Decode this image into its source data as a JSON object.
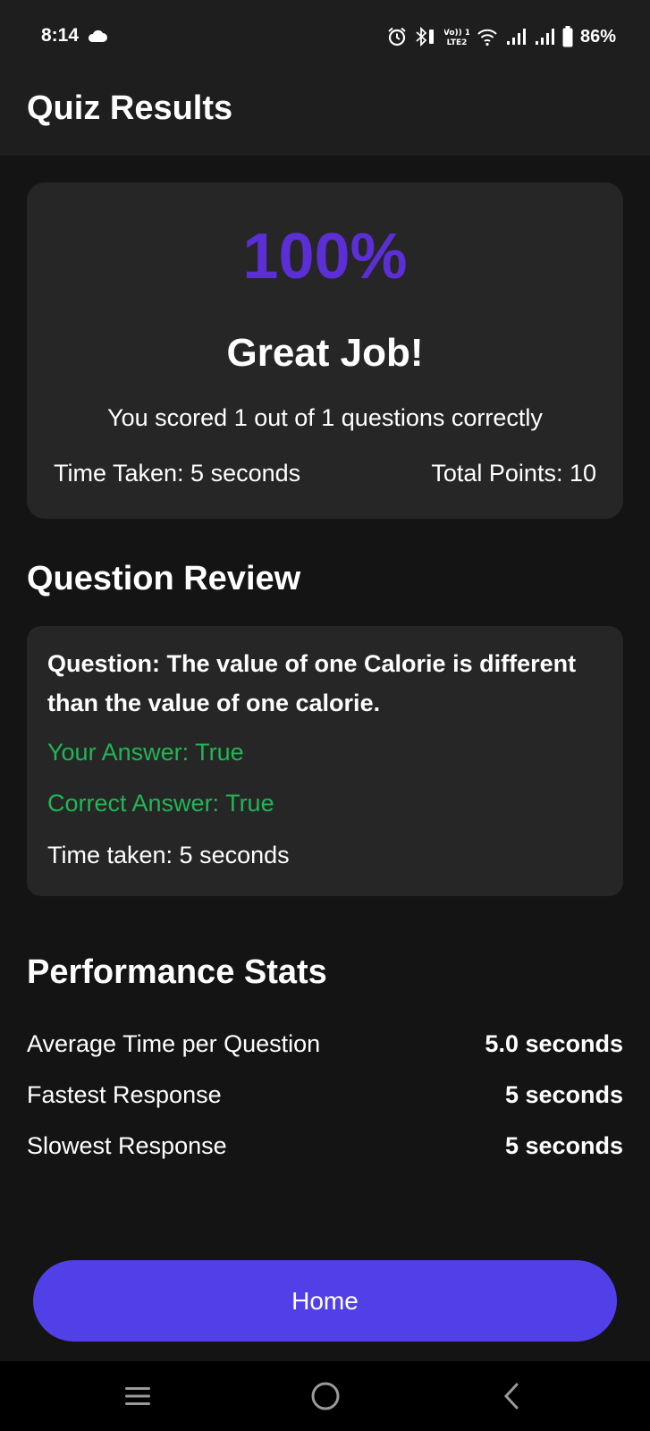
{
  "status_bar": {
    "time": "8:14",
    "battery": "86%",
    "network_label_top": "Vo)) 1",
    "network_label_bottom": "LTE2"
  },
  "header": {
    "title": "Quiz Results"
  },
  "score": {
    "percent": "100%",
    "message": "Great Job!",
    "summary": "You scored 1 out of 1 questions correctly",
    "time_taken": "Time Taken: 5 seconds",
    "total_points": "Total Points: 10"
  },
  "review": {
    "heading": "Question Review",
    "question": "Question: The value of one Calorie is different than the value of one calorie.",
    "your_answer": "Your Answer: True",
    "correct_answer": "Correct Answer: True",
    "time": "Time taken: 5 seconds"
  },
  "stats": {
    "heading": "Performance Stats",
    "rows": [
      {
        "label": "Average Time per Question",
        "value": "5.0 seconds"
      },
      {
        "label": "Fastest Response",
        "value": "5 seconds"
      },
      {
        "label": "Slowest Response",
        "value": "5 seconds"
      }
    ]
  },
  "home_button": {
    "label": "Home"
  },
  "colors": {
    "accent_score": "#5c2ed6",
    "button": "#5140e8",
    "correct": "#22b556",
    "background": "#141414",
    "card": "#262626"
  },
  "icons": [
    "cloud-icon",
    "alarm-icon",
    "bluetooth-icon",
    "wifi-icon",
    "signal-icon",
    "battery-icon",
    "recents-icon",
    "home-circle-icon",
    "back-icon"
  ]
}
